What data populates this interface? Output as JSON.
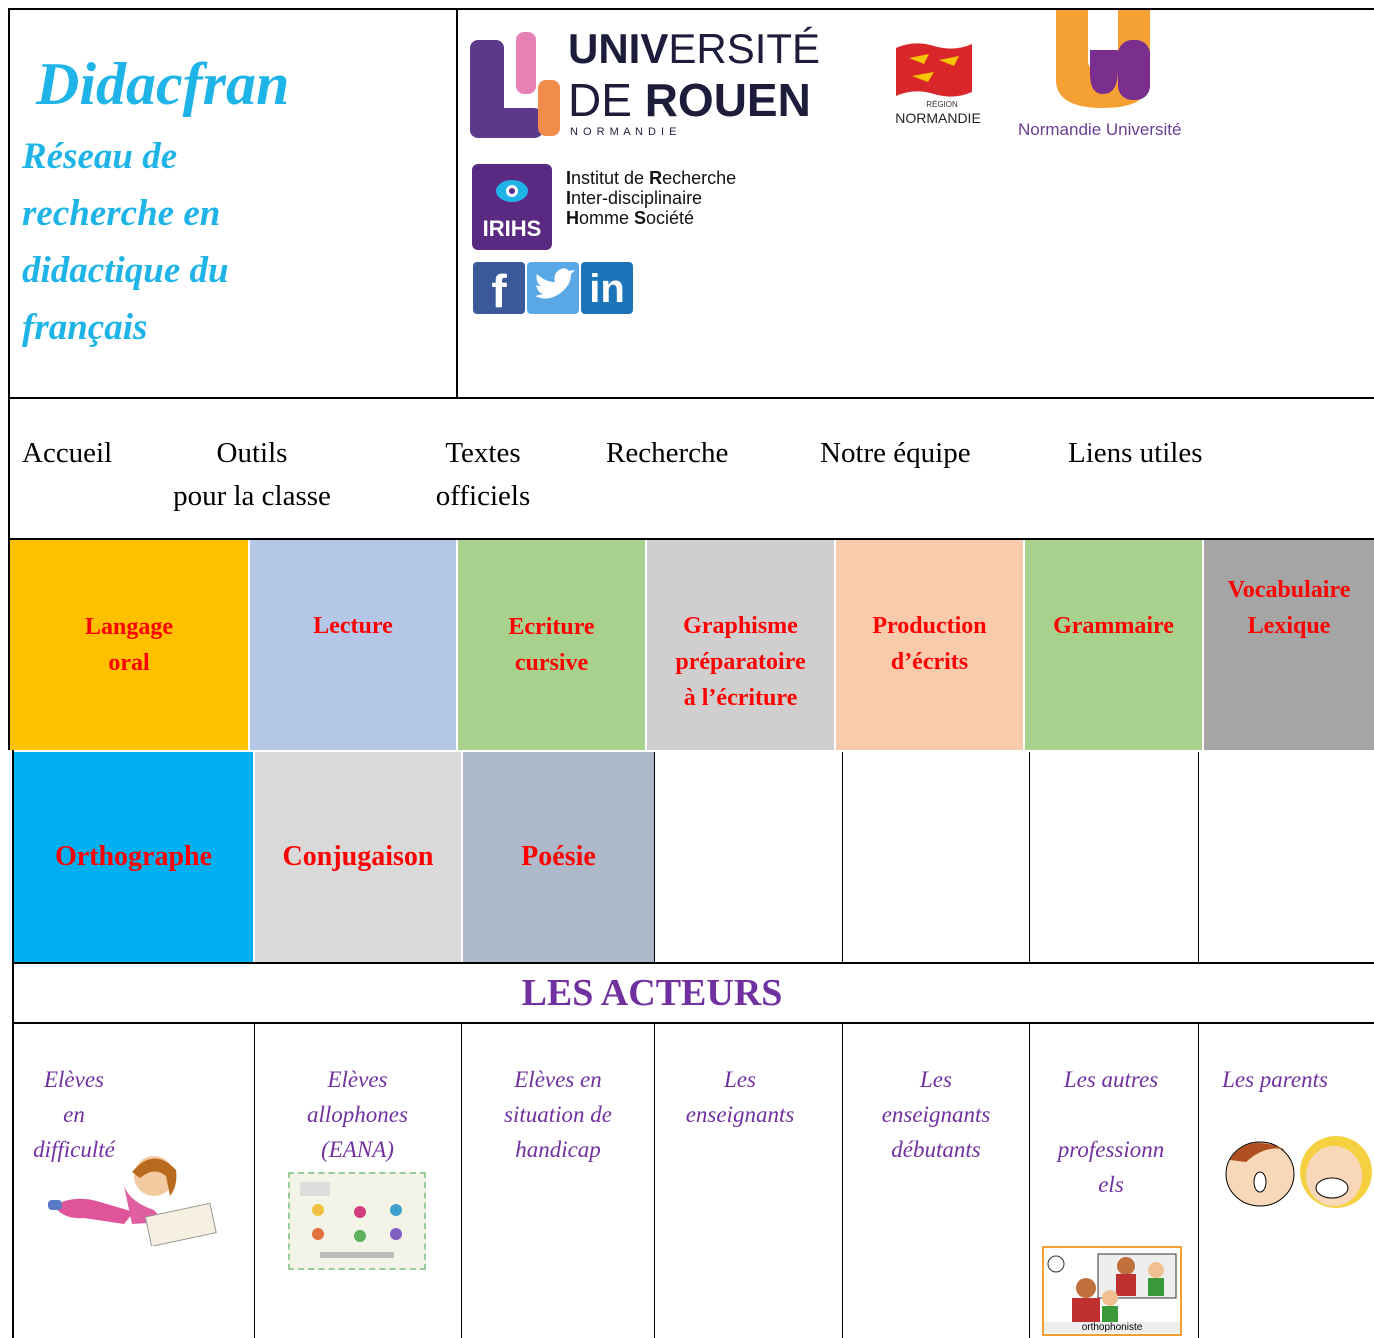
{
  "header": {
    "site_title": "Didacfran",
    "subtitle": "Réseau de\nrecherche en\ndidactique du\nfrançais"
  },
  "logos": {
    "univ_rouen": {
      "line1a": "UNIV",
      "line1b": "ERSITÉ",
      "line2a": "DE ",
      "line2b": "ROUEN",
      "line3": "N O R M A N D I E"
    },
    "region": {
      "small": "RÉGION",
      "name": "NORMANDIE"
    },
    "normandie_univ": "Normandie Université",
    "irihs": {
      "badge": "IRIHS",
      "l1a": "I",
      "l1b": "nstitut de ",
      "l1c": "R",
      "l1d": "echerche",
      "l2a": "I",
      "l2b": "nter-disciplinaire",
      "l3a": "H",
      "l3b": "omme ",
      "l3c": "S",
      "l3d": "ociété"
    },
    "social": {
      "facebook": "f",
      "linkedin": "in"
    }
  },
  "nav": [
    {
      "label": "Accueil"
    },
    {
      "label": "Outils\npour la classe"
    },
    {
      "label": "Textes\nofficiels"
    },
    {
      "label": "Recherche"
    },
    {
      "label": "Notre équipe"
    },
    {
      "label": "Liens utiles"
    }
  ],
  "tiles_row1": [
    {
      "label": "Langage\noral",
      "color": "#ffc000"
    },
    {
      "label": "Lecture",
      "color": "#b4c7e7"
    },
    {
      "label": "Ecriture\ncursive",
      "color": "#a9d18e"
    },
    {
      "label": "Graphisme\npréparatoire\nà l’écriture",
      "color": "#d0cece"
    },
    {
      "label": "Production\nd’écrits",
      "color": "#f8cbad"
    },
    {
      "label": "Grammaire",
      "color": "#a9d18e"
    },
    {
      "label": "Vocabulaire\nLexique",
      "color": "#a5a5a5"
    }
  ],
  "tiles_row2": [
    {
      "label": "Orthographe",
      "color": "#00b0f0"
    },
    {
      "label": "Conjugaison",
      "color": "#d9d9d9"
    },
    {
      "label": "Poésie",
      "color": "#adb9ca"
    }
  ],
  "acteurs": {
    "heading": "LES ACTEURS",
    "items": [
      {
        "label": "Elèves\nen\ndifficulté"
      },
      {
        "label": "Elèves\nallophones\n(EANA)"
      },
      {
        "label": "Elèves en\nsituation de\nhandicap"
      },
      {
        "label": "Les\nenseignants"
      },
      {
        "label": "Les\nenseignants\ndébutants"
      },
      {
        "label": "Les autres\n\nprofessionn\nels"
      },
      {
        "label": "Les parents"
      }
    ],
    "ortho_caption": "orthophoniste"
  },
  "colors": {
    "title_blue": "#1fb4e8",
    "actor_purple": "#7030a0",
    "tile_text": "#ff0000"
  }
}
